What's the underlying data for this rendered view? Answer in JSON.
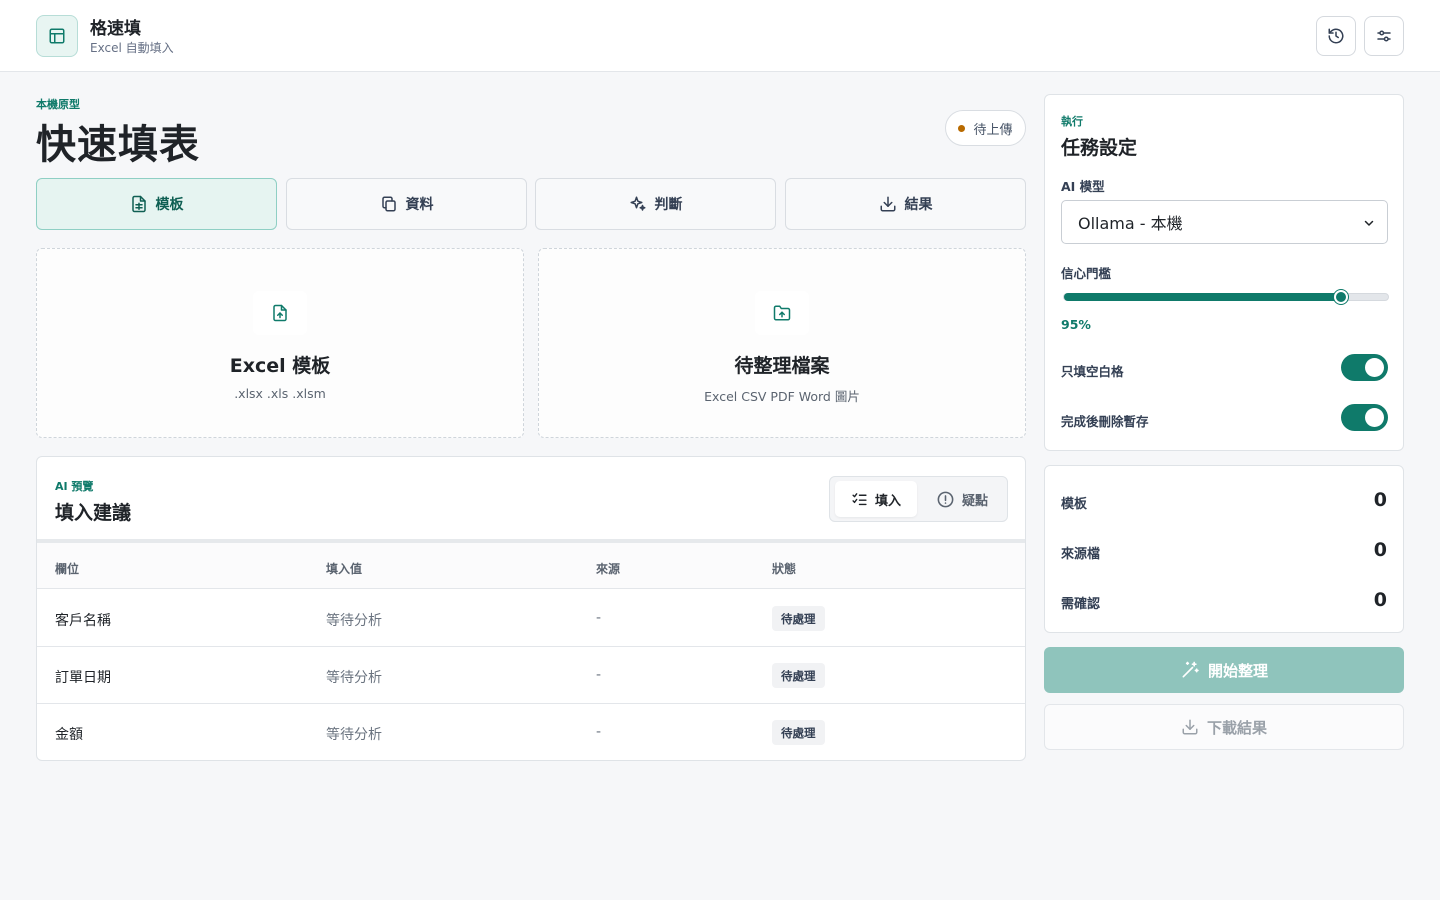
{
  "app": {
    "name": "格速填",
    "subtitle": "Excel 自動填入"
  },
  "header": {
    "history_icon": "history-icon",
    "settings_icon": "sliders-icon"
  },
  "page": {
    "eyebrow": "本機原型",
    "title": "快速填表",
    "status": "待上傳",
    "status_color": "#b86a00"
  },
  "tabs": [
    {
      "label": "模板",
      "icon": "file-sheet-icon",
      "active": true
    },
    {
      "label": "資料",
      "icon": "copy-files-icon",
      "active": false
    },
    {
      "label": "判斷",
      "icon": "sparkles-icon",
      "active": false
    },
    {
      "label": "結果",
      "icon": "download-icon",
      "active": false
    }
  ],
  "uploads": [
    {
      "title": "Excel 模板",
      "subtitle": ".xlsx .xls .xlsm",
      "icon": "file-upload-icon"
    },
    {
      "title": "待整理檔案",
      "subtitle": "Excel CSV PDF Word 圖片",
      "icon": "folder-upload-icon"
    }
  ],
  "preview": {
    "eyebrow": "AI 預覽",
    "title": "填入建議",
    "segments": [
      {
        "label": "填入",
        "icon": "checklist-icon",
        "active": true
      },
      {
        "label": "疑點",
        "icon": "alert-circle-icon",
        "active": false
      }
    ],
    "columns": [
      "欄位",
      "填入值",
      "來源",
      "狀態"
    ],
    "rows": [
      {
        "field": "客戶名稱",
        "value": "等待分析",
        "source": "-",
        "status": "待處理"
      },
      {
        "field": "訂單日期",
        "value": "等待分析",
        "source": "-",
        "status": "待處理"
      },
      {
        "field": "金額",
        "value": "等待分析",
        "source": "-",
        "status": "待處理"
      }
    ]
  },
  "settings": {
    "eyebrow": "執行",
    "title": "任務設定",
    "model_label": "AI 模型",
    "model_value": "Ollama - 本機",
    "threshold_label": "信心門檻",
    "threshold_value": "95%",
    "threshold_fraction": 0.85,
    "only_blank_label": "只填空白格",
    "only_blank_on": true,
    "delete_temp_label": "完成後刪除暫存",
    "delete_temp_on": true
  },
  "stats": [
    {
      "label": "模板",
      "value": "0"
    },
    {
      "label": "來源檔",
      "value": "0"
    },
    {
      "label": "需確認",
      "value": "0"
    }
  ],
  "actions": {
    "start_label": "開始整理",
    "download_label": "下載結果"
  },
  "colors": {
    "accent": "#0f7a6a",
    "accent_light": "#e6f4f1",
    "disabled_accent": "#8fc4bc"
  }
}
